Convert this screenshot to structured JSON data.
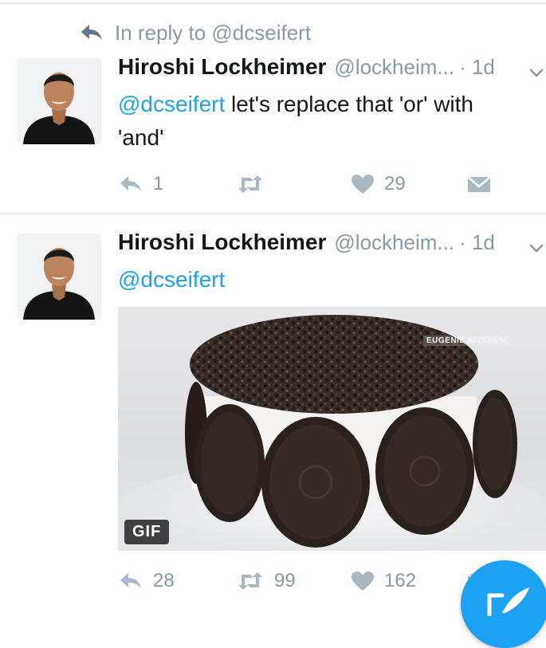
{
  "reply_context": {
    "text": "In reply to @dcseifert",
    "icon": "reply-arrow-icon"
  },
  "tweets": [
    {
      "author_name": "Hiroshi Lockheimer",
      "handle": "@lockheim...",
      "time": "· 1d",
      "mention": "@dcseifert",
      "text_line1": " let's replace that 'or' with",
      "text_line2": "'and'",
      "actions": {
        "reply_count": "1",
        "retweet_count": "",
        "like_count": "29"
      }
    },
    {
      "author_name": "Hiroshi Lockheimer",
      "handle": "@lockheim...",
      "time": "· 1d",
      "mention": "@dcseifert",
      "media": {
        "badge": "GIF",
        "watermark": "EUGENIE KITCHEN"
      },
      "actions": {
        "reply_count": "28",
        "retweet_count": "99",
        "like_count": "162"
      }
    }
  ],
  "compose_button": {
    "icon": "compose-feather-icon"
  },
  "colors": {
    "accent": "#1da1f2",
    "muted": "#8899a6",
    "text": "#14171a",
    "divider": "#e1e8ed"
  }
}
